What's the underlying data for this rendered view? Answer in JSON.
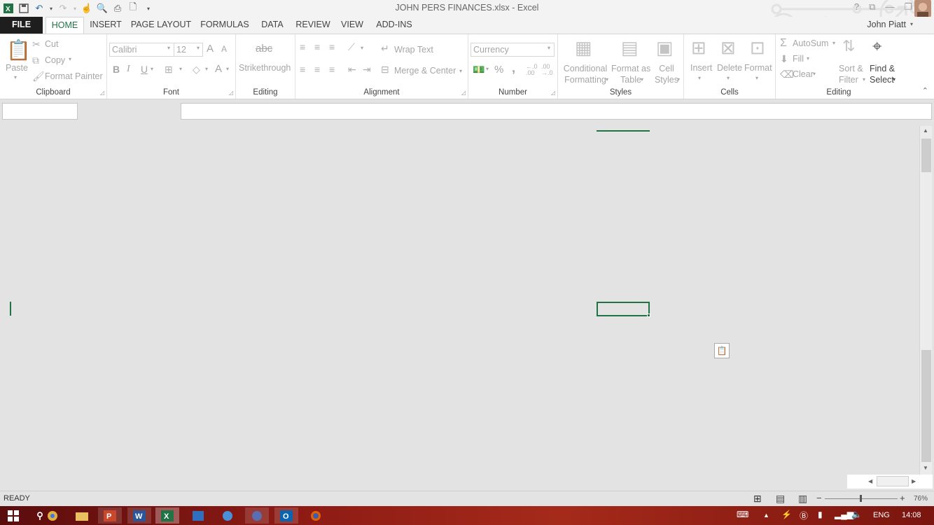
{
  "window": {
    "title": "JOHN PERS FINANCES.xlsx - Excel"
  },
  "qat": [
    {
      "icon": "excel-logo-icon"
    },
    {
      "icon": "save-icon"
    },
    {
      "icon": "undo-icon"
    },
    {
      "icon": "redo-icon"
    },
    {
      "icon": "touch-mode-icon"
    },
    {
      "icon": "print-preview-icon"
    },
    {
      "icon": "quick-print-icon"
    },
    {
      "icon": "new-document-icon"
    },
    {
      "icon": "customize-qat-icon"
    }
  ],
  "tabs": [
    "FILE",
    "HOME",
    "INSERT",
    "PAGE LAYOUT",
    "FORMULAS",
    "DATA",
    "REVIEW",
    "VIEW",
    "ADD-INS"
  ],
  "user": {
    "name": "John Piatt"
  },
  "ribbon": {
    "clipboard": {
      "paste": "Paste",
      "cut": "Cut",
      "copy": "Copy",
      "format_painter": "Format Painter",
      "label": "Clipboard"
    },
    "font": {
      "name": "Calibri",
      "size": "12",
      "bold": "B",
      "italic": "I",
      "underline": "U",
      "font_color": "A",
      "grow": "A",
      "shrink": "A",
      "label": "Font"
    },
    "editing1": {
      "strike_icon": "abc",
      "strikethrough": "Strikethrough",
      "label": "Editing"
    },
    "alignment": {
      "wrap": "Wrap Text",
      "merge": "Merge & Center",
      "label": "Alignment"
    },
    "number": {
      "format": "Currency",
      "percent": "%",
      "comma": ",",
      "label": "Number"
    },
    "styles": {
      "conditional": [
        "Conditional",
        "Formatting"
      ],
      "format_table": [
        "Format as",
        "Table"
      ],
      "cell_styles": [
        "Cell",
        "Styles"
      ],
      "label": "Styles"
    },
    "cells": {
      "insert": "Insert",
      "delete": "Delete",
      "format": "Format",
      "label": "Cells"
    },
    "editing2": {
      "autosum": "AutoSum",
      "fill": "Fill",
      "clear": "Clear",
      "sort": [
        "Sort &",
        "Filter"
      ],
      "find": [
        "Find &",
        "Select"
      ],
      "label": "Editing"
    }
  },
  "status": {
    "ready": "READY",
    "zoom": "76%"
  },
  "tray": {
    "lang": "ENG",
    "time": "14:08"
  },
  "colors": {
    "accent": "#217346",
    "file_tab": "#1e1e1e"
  }
}
